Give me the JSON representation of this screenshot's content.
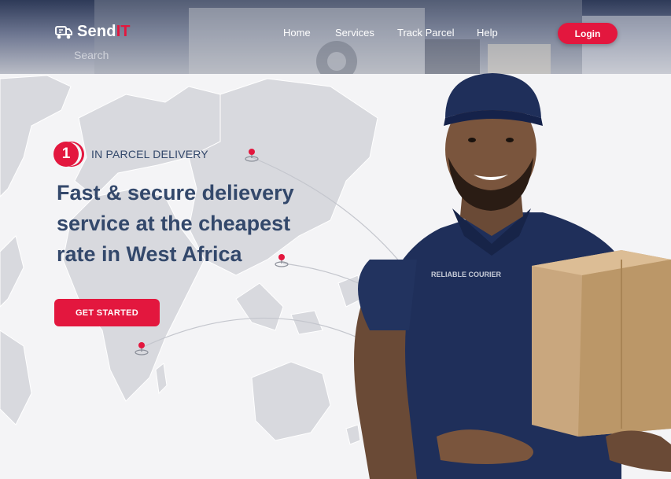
{
  "header": {
    "logo_text": "Send",
    "logo_accent": "IT",
    "search_placeholder": "Search",
    "nav": [
      {
        "label": "Home"
      },
      {
        "label": "Services"
      },
      {
        "label": "Track Parcel"
      },
      {
        "label": "Help"
      }
    ],
    "login_label": "Login"
  },
  "hero": {
    "badge_number": "1",
    "badge_text": "IN PARCEL DELIVERY",
    "title": "Fast & secure delievery service at the cheapest rate in West Africa",
    "cta_label": "GET STARTED",
    "shirt_logo": "RELIABLE COURIER"
  },
  "colors": {
    "accent": "#e3173e",
    "heading": "#33486b",
    "shirt": "#1f2f5a",
    "box": "#c9a77e"
  },
  "icons": [
    "delivery-truck-icon",
    "map-pin-icon"
  ]
}
